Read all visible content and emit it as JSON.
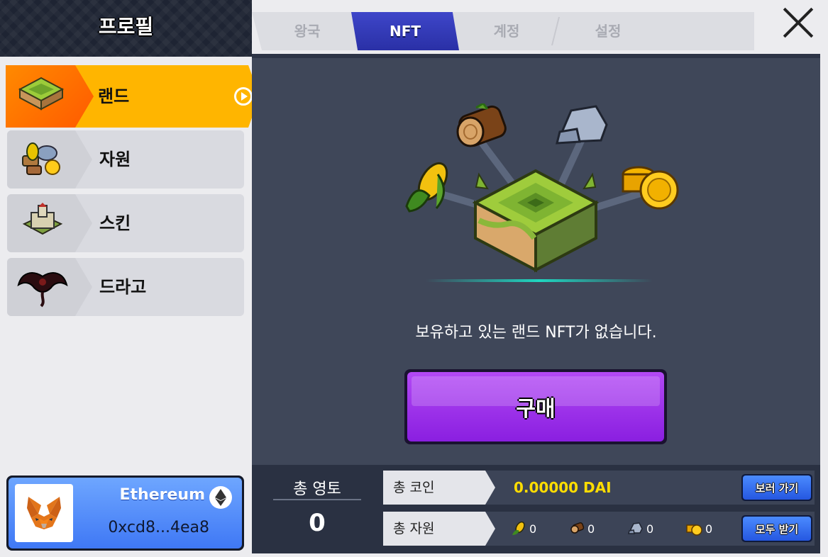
{
  "left_panel": {
    "title": "프로필",
    "menu": [
      {
        "label": "랜드",
        "icon": "land-icon",
        "active": true
      },
      {
        "label": "자원",
        "icon": "resources-icon",
        "active": false
      },
      {
        "label": "스킨",
        "icon": "castle-skin-icon",
        "active": false
      },
      {
        "label": "드라고",
        "icon": "dragon-icon",
        "active": false
      }
    ],
    "wallet": {
      "chain": "Ethereum",
      "address": "0xcd8...4ea8",
      "icon": "metamask-fox-icon"
    }
  },
  "tabs": [
    {
      "label": "왕국",
      "active": false
    },
    {
      "label": "NFT",
      "active": true
    },
    {
      "label": "계정",
      "active": false
    },
    {
      "label": "설정",
      "active": false
    }
  ],
  "main": {
    "empty_message": "보유하고 있는 랜드 NFT가 없습니다.",
    "buy_label": "구매"
  },
  "bottom": {
    "territory_label": "총 영토",
    "territory_value": "0",
    "coin_label": "총 코인",
    "coin_value": "0.00000 DAI",
    "coin_button": "보러 가기",
    "resource_label": "총 자원",
    "resources": [
      {
        "icon": "corn-icon",
        "value": "0"
      },
      {
        "icon": "wood-icon",
        "value": "0"
      },
      {
        "icon": "stone-icon",
        "value": "0"
      },
      {
        "icon": "gold-icon",
        "value": "0"
      }
    ],
    "resource_button": "모두 받기"
  },
  "colors": {
    "active_menu": "#ffb500",
    "active_tab": "#3e46c9",
    "buy_button": "#a236f0",
    "coin_value": "#ffdd00",
    "panel": "#3f4759"
  }
}
